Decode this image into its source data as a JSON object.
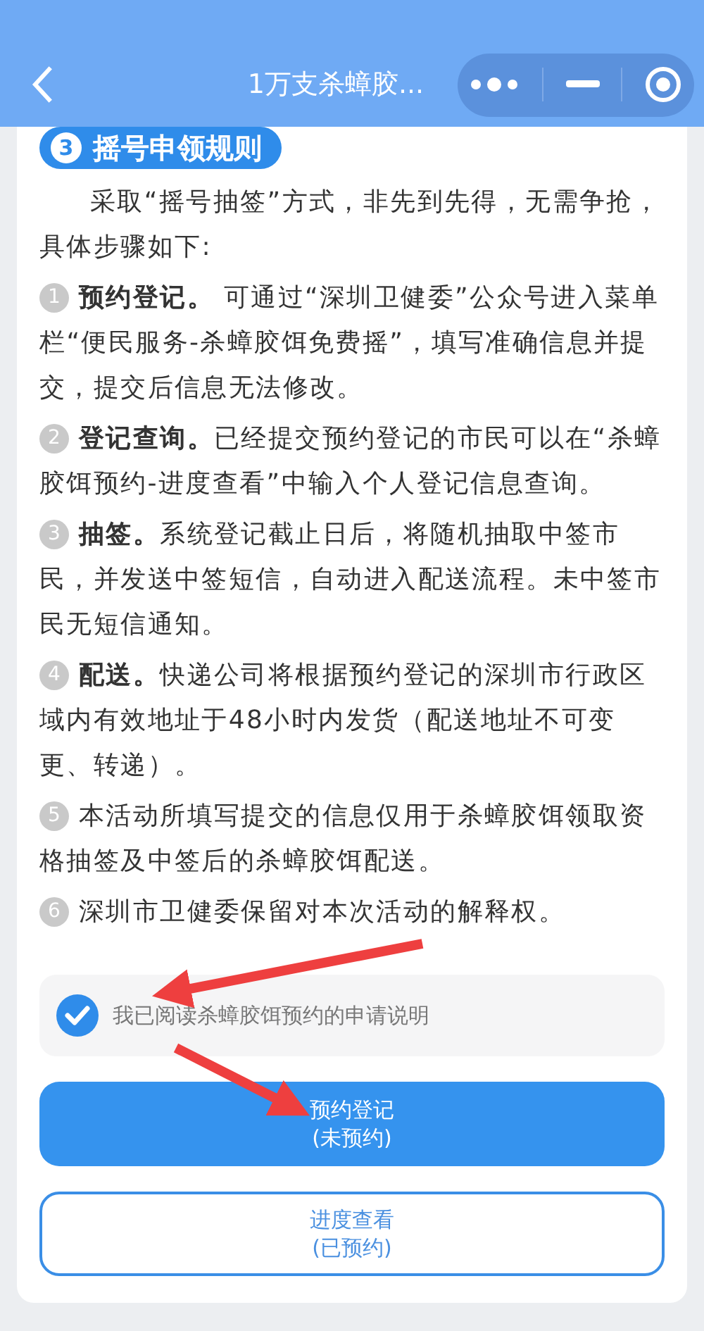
{
  "nav_bar": {
    "title": "1万支杀蟑胶..."
  },
  "section": {
    "number": "3",
    "title": "摇号申领规则"
  },
  "intro": "采取“摇号抽签”方式，非先到先得，无需争抢，具体步骤如下:",
  "steps": [
    {
      "number": "1",
      "text": "**预约登记。** 可通过“深圳卫健委”公众号进入菜单栏“便民服务-杀蟑胶饵免费摇”，填写准确信息并提交，提交后信息无法修改。"
    },
    {
      "number": "2",
      "text": "**登记查询。**已经提交预约登记的市民可以在“杀蟑胶饵预约-进度查看”中输入个人登记信息查询。"
    },
    {
      "number": "3",
      "text": "**抽签。**系统登记截止日后，将随机抽取中签市民，并发送中签短信，自动进入配送流程。未中签市民无短信通知。"
    },
    {
      "number": "4",
      "text": "**配送。**快递公司将根据预约登记的深圳市行政区域内有效地址于48小时内发货（配送地址不可变更、转递）。"
    },
    {
      "number": "5",
      "text": "本活动所填写提交的信息仅用于杀蟑胶饵领取资格抽签及中签后的杀蟑胶饵配送。"
    },
    {
      "number": "6",
      "text": "深圳市卫健委保留对本次活动的解释权。"
    }
  ],
  "agreement": {
    "label": "我已阅读杀蟑胶饵预约的申请说明",
    "checked": true
  },
  "buttons": [
    {
      "kind": "primary",
      "label": "预约登记",
      "status": "(未预约)"
    },
    {
      "kind": "outline",
      "label": "进度查看",
      "status": "(已预约)"
    }
  ]
}
